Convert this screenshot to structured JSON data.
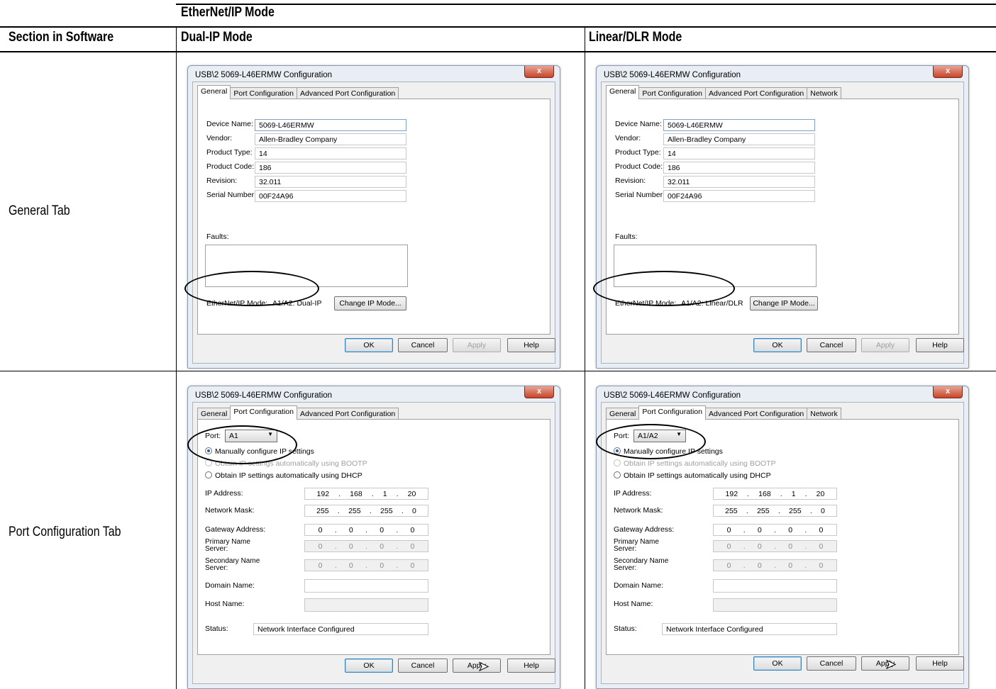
{
  "table": {
    "group_header": "EtherNet/IP Mode",
    "col_section": "Section in Software",
    "col_dual": "Dual-IP Mode",
    "col_linear": "Linear/DLR Mode",
    "row_general": "General Tab",
    "row_port": "Port Configuration Tab"
  },
  "dialog": {
    "title": "USB\\2 5069-L46ERMW Configuration",
    "close": "x",
    "tab_general": "General",
    "tab_port": "Port Configuration",
    "tab_adv": "Advanced Port Configuration",
    "tab_network": "Network",
    "ok": "OK",
    "cancel": "Cancel",
    "apply": "Apply",
    "help": "Help"
  },
  "general": {
    "device_name_label": "Device Name:",
    "device_name": "5069-L46ERMW",
    "vendor_label": "Vendor:",
    "vendor": "Allen-Bradley Company",
    "product_type_label": "Product Type:",
    "product_type": "14",
    "product_code_label": "Product Code:",
    "product_code": "186",
    "revision_label": "Revision:",
    "revision": "32.011",
    "serial_label": "Serial Number:",
    "serial": "00F24A96",
    "faults_label": "Faults:",
    "mode_label": "EtherNet/IP Mode:",
    "mode_dual": "A1/A2: Dual-IP",
    "mode_linear": "A1/A2: Linear/DLR",
    "change_ip_mode": "Change IP Mode..."
  },
  "port": {
    "port_label": "Port:",
    "port_dual": "A1",
    "port_linear": "A1/A2",
    "manual": "Manually configure IP settings",
    "bootp": "Obtain IP settings automatically using BOOTP",
    "dhcp": "Obtain IP settings automatically using DHCP",
    "ip_label": "IP Address:",
    "mask_label": "Network Mask:",
    "gateway_label": "Gateway Address:",
    "primary_label_1": "Primary Name",
    "primary_label_2": "Server:",
    "secondary_label_1": "Secondary Name",
    "secondary_label_2": "Server:",
    "domain_label": "Domain Name:",
    "host_label": "Host Name:",
    "status_label": "Status:",
    "status": "Network Interface Configured",
    "ip": [
      "192",
      "168",
      "1",
      "20"
    ],
    "mask": [
      "255",
      "255",
      "255",
      "0"
    ],
    "zero": [
      "0",
      "0",
      "0",
      "0"
    ]
  }
}
